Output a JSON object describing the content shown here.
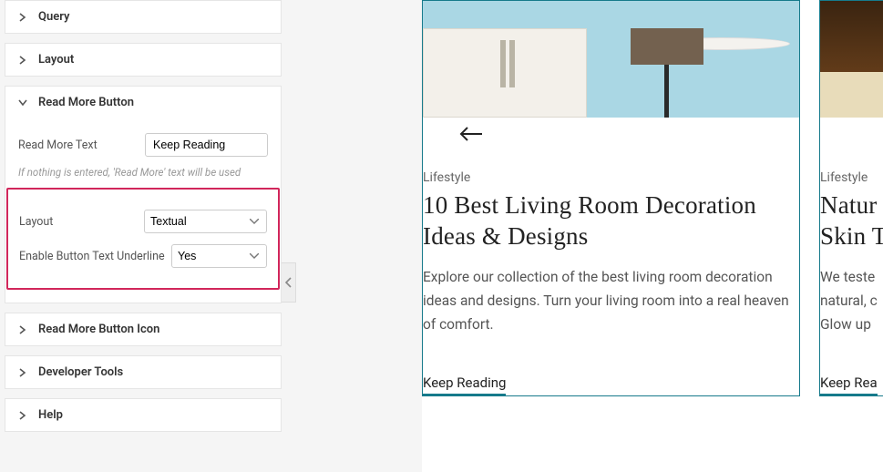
{
  "sidebar": {
    "panels": {
      "query": {
        "label": "Query"
      },
      "layout": {
        "label": "Layout"
      },
      "readmore": {
        "label": "Read More Button",
        "text_label": "Read More Text",
        "text_value": "Keep Reading",
        "helper": "If nothing is entered, 'Read More' text will be used",
        "layout_label": "Layout",
        "layout_value": "Textual",
        "underline_label": "Enable Button Text Underline",
        "underline_value": "Yes"
      },
      "readmore_icon": {
        "label": "Read More Button Icon"
      },
      "developer": {
        "label": "Developer Tools"
      },
      "help": {
        "label": "Help"
      }
    }
  },
  "preview": {
    "posts": [
      {
        "category": "Lifestyle",
        "title": "10 Best Living Room Decoration Ideas & Designs",
        "excerpt": "Explore our collection of the best living room decoration ideas and designs. Turn your living room into a real heaven of comfort.",
        "readmore": "Keep Reading"
      },
      {
        "category": "Lifestyle",
        "title": "Natur",
        "excerpt1": "Skin T",
        "excerpt2a": "We teste",
        "excerpt2b": "natural, c",
        "excerpt2c": "Glow up",
        "readmore": "Keep Rea"
      }
    ]
  }
}
